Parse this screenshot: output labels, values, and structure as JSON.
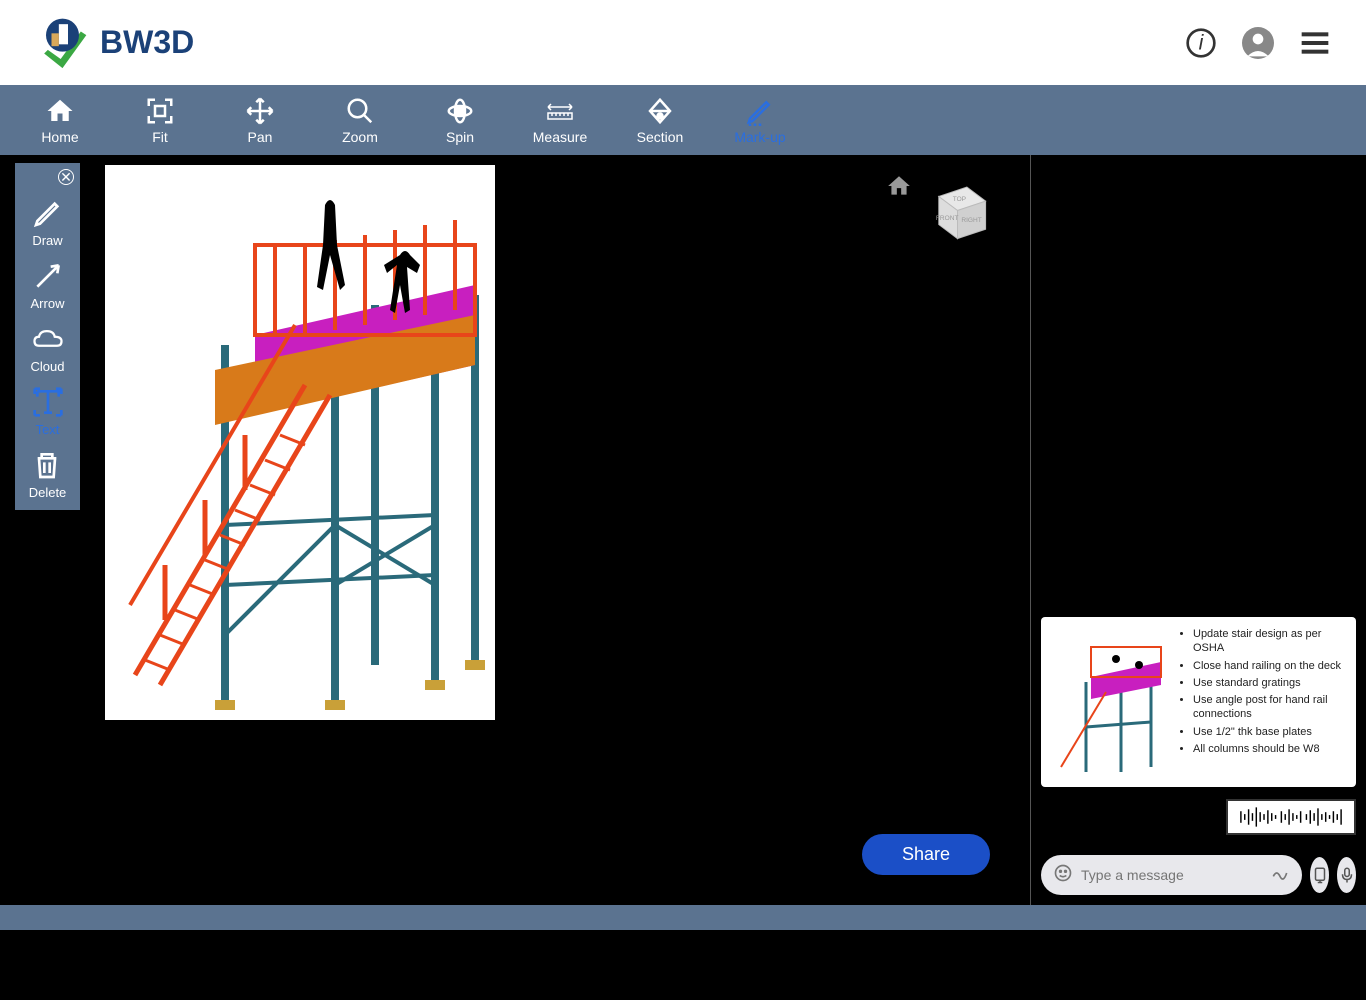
{
  "brand": "BW3D",
  "toolbar": [
    {
      "id": "home",
      "label": "Home"
    },
    {
      "id": "fit",
      "label": "Fit"
    },
    {
      "id": "pan",
      "label": "Pan"
    },
    {
      "id": "zoom",
      "label": "Zoom"
    },
    {
      "id": "spin",
      "label": "Spin"
    },
    {
      "id": "measure",
      "label": "Measure"
    },
    {
      "id": "section",
      "label": "Section"
    },
    {
      "id": "markup",
      "label": "Mark-up",
      "active": true
    }
  ],
  "markup_tools": [
    {
      "id": "draw",
      "label": "Draw"
    },
    {
      "id": "arrow",
      "label": "Arrow"
    },
    {
      "id": "cloud",
      "label": "Cloud"
    },
    {
      "id": "text",
      "label": "Text",
      "active": true
    },
    {
      "id": "delete",
      "label": "Delete"
    }
  ],
  "viewcube": {
    "faces": {
      "top": "TOP",
      "front": "FRONT",
      "right": "RIGHT"
    }
  },
  "share_label": "Share",
  "chat": {
    "notes": [
      "Update stair design as per OSHA",
      "Close hand railing on the deck",
      "Use standard gratings",
      "Use angle post for hand rail connections",
      "Use 1/2\" thk base plates",
      "All columns should be W8"
    ],
    "input_placeholder": "Type a message"
  }
}
